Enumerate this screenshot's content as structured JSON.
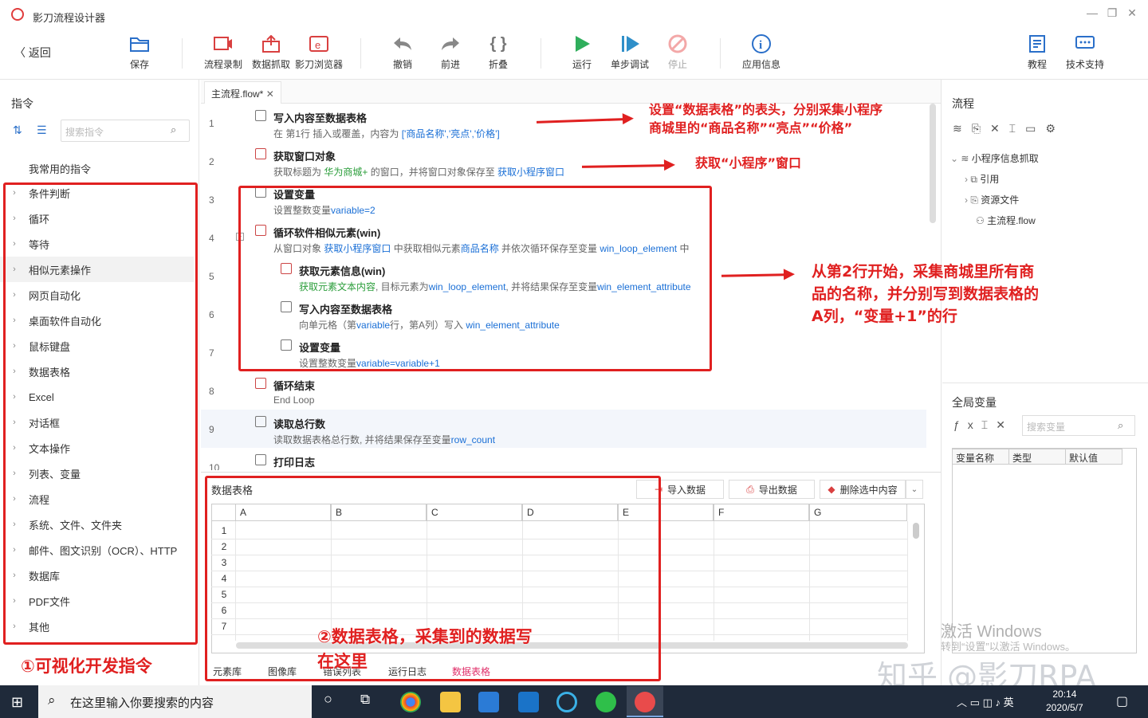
{
  "app": {
    "title": "影刀流程设计器"
  },
  "window": {
    "minimize": "—",
    "restore": "❐",
    "close": "✕"
  },
  "toolbar": {
    "back": "返回",
    "save": "保存",
    "record": "流程录制",
    "grab": "数据抓取",
    "browser": "影刀浏览器",
    "undo": "撤销",
    "redo": "前进",
    "fold": "折叠",
    "run": "运行",
    "step": "单步调试",
    "stop": "停止",
    "info": "应用信息",
    "tutorial": "教程",
    "support": "技术支持"
  },
  "left": {
    "title": "指令",
    "search_placeholder": "搜索指令",
    "frequent": "我常用的指令",
    "categories": [
      "条件判断",
      "循环",
      "等待",
      "相似元素操作",
      "网页自动化",
      "桌面软件自动化",
      "鼠标键盘",
      "数据表格",
      "Excel",
      "对话框",
      "文本操作",
      "列表、变量",
      "流程",
      "系统、文件、文件夹",
      "邮件、图文识别（OCR）、HTTP",
      "数据库",
      "PDF文件",
      "其他"
    ]
  },
  "tab": {
    "label": "主流程.flow*",
    "close": "✕"
  },
  "flow": [
    {
      "n": "1",
      "title": "写入内容至数据表格",
      "d1": "在 第1行 插入或覆盖，内容为 ",
      "d2": "['商品名称','亮点','价格']"
    },
    {
      "n": "2",
      "title": "获取窗口对象",
      "d1": "获取标题为 ",
      "d2": "华为商城+",
      "d3": " 的窗口，并将窗口对象保存至 ",
      "d4": "获取小程序窗口"
    },
    {
      "n": "3",
      "title": "设置变量",
      "d1": "设置整数变量",
      "d2": "variable=2"
    },
    {
      "n": "4",
      "title": "循环软件相似元素(win)",
      "d1": "从窗口对象 ",
      "d2": "获取小程序窗口",
      "d3": " 中获取相似元素",
      "d4": "商品名称",
      "d5": " 并依次循环保存至变量 ",
      "d6": "win_loop_element",
      "d7": " 中"
    },
    {
      "n": "5",
      "title": "获取元素信息(win)",
      "d1": "获取元素文本内容",
      "d2": ", 目标元素为",
      "d3": "win_loop_element",
      "d4": ", 并将结果保存至变量",
      "d5": "win_element_attribute"
    },
    {
      "n": "6",
      "title": "写入内容至数据表格",
      "d1": "向单元格（第",
      "d2": "variable",
      "d3": "行，第A列）写入 ",
      "d4": "win_element_attribute"
    },
    {
      "n": "7",
      "title": "设置变量",
      "d1": "设置整数变量",
      "d2": "variable=variable+1"
    },
    {
      "n": "8",
      "title": "循环结束",
      "d1": "End Loop"
    },
    {
      "n": "9",
      "title": "读取总行数",
      "d1": "读取数据表格总行数, 并将结果保存至变量",
      "d2": "row_count"
    },
    {
      "n": "10",
      "title": "打印日志"
    }
  ],
  "datatable": {
    "title": "数据表格",
    "import": "导入数据",
    "export": "导出数据",
    "delete": "删除选中内容",
    "columns": [
      "A",
      "B",
      "C",
      "D",
      "E",
      "F",
      "G"
    ],
    "rows": [
      "1",
      "2",
      "3",
      "4",
      "5",
      "6",
      "7"
    ],
    "tabs": [
      "元素库",
      "图像库",
      "错误列表",
      "运行日志",
      "数据表格"
    ]
  },
  "right": {
    "flow_title": "流程",
    "project": "小程序信息抓取",
    "ref": "引用",
    "resources": "资源文件",
    "main_flow": "主流程.flow",
    "globals_title": "全局变量",
    "search_placeholder": "搜索变量",
    "var_cols": [
      "变量名称",
      "类型",
      "默认值"
    ]
  },
  "annotations": {
    "a1": "设置“数据表格”的表头，分别采集小程序商城里的“商品名称”“亮点”“价格”",
    "a2": "获取“小程序”窗口",
    "a3": "从第2行开始，采集商城里所有商品的名称，并分别写到数据表格的A列，“变量+1”的行",
    "a4": "②数据表格，采集到的数据写在这里",
    "a5": "①可视化开发指令"
  },
  "watermark": {
    "w1": "激活 Windows",
    "w2": "转到“设置”以激活 Windows。",
    "zhihu": "知乎 @影刀RPA"
  },
  "taskbar": {
    "search": "在这里输入你要搜索的内容",
    "ime": "英",
    "time": "20:14",
    "date": "2020/5/7"
  },
  "colors": {
    "accent": "#1a6fd6",
    "annotation": "#e02020",
    "taskbar": "#1f2a3a"
  }
}
